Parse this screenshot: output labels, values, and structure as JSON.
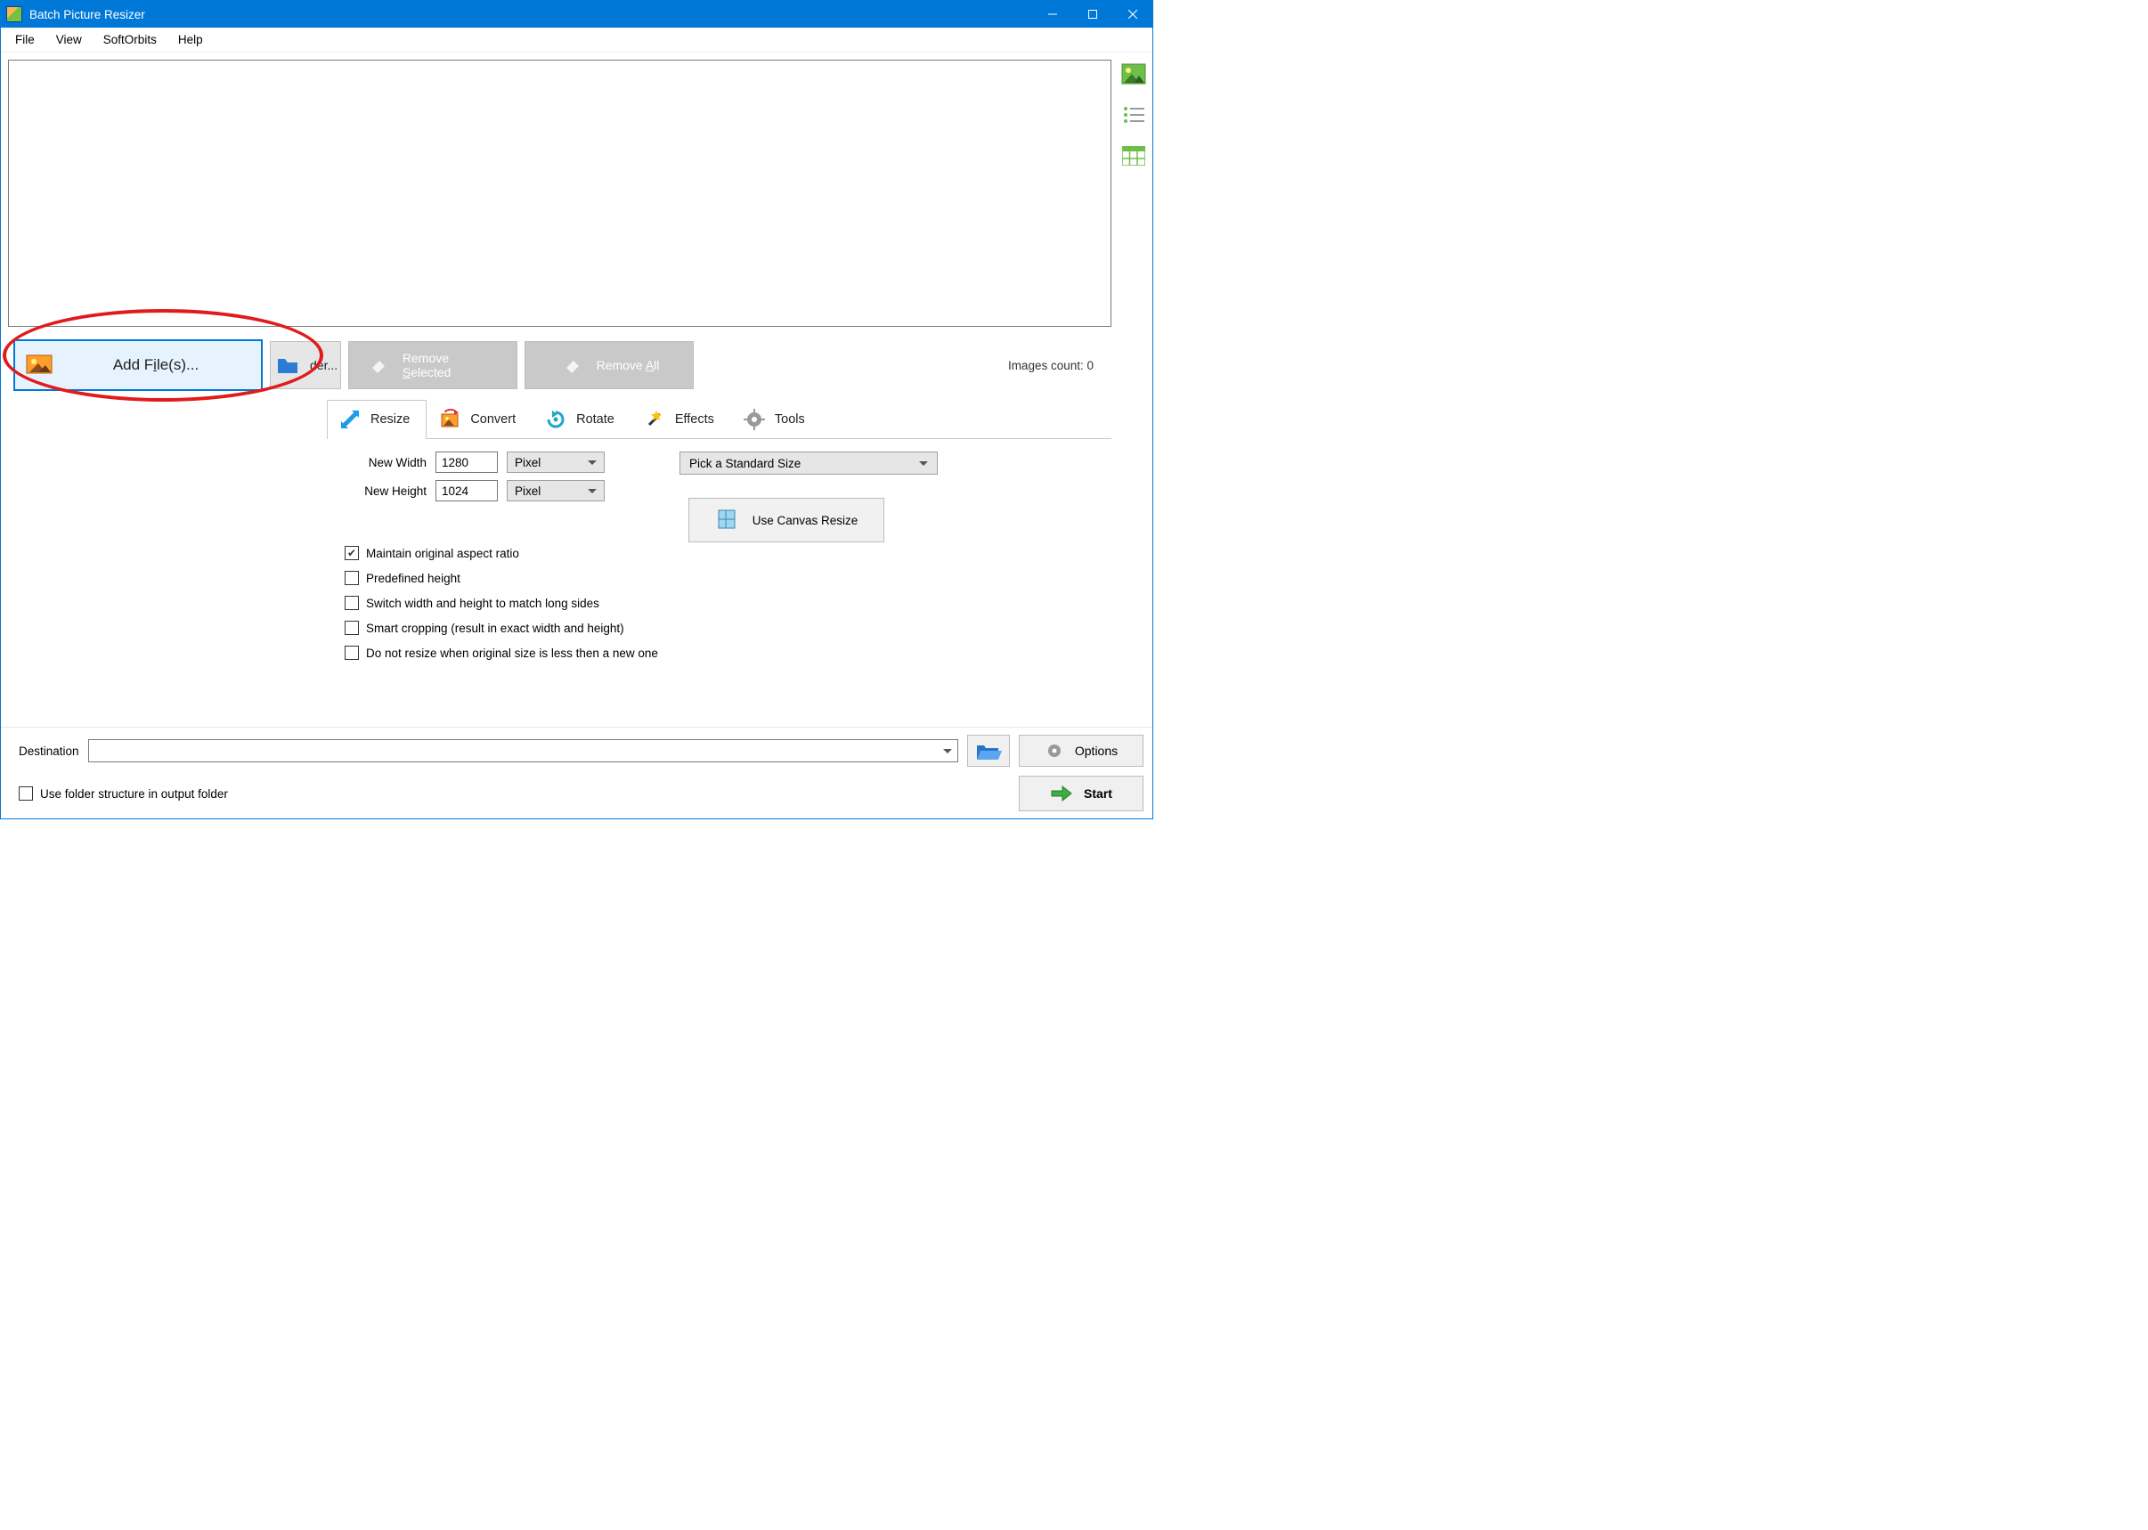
{
  "colors": {
    "accent": "#0078d7",
    "annotation": "#e11b1b"
  },
  "titlebar": {
    "title": "Batch Picture Resizer"
  },
  "menu": {
    "file": "File",
    "view": "View",
    "softorbits": "SoftOrbits",
    "help": "Help"
  },
  "fileops": {
    "add_files": "Add File(s)...",
    "add_folder_tail": "der...",
    "remove_selected_pre": "Remove ",
    "remove_selected_u": "S",
    "remove_selected_post": "elected",
    "remove_all_pre": "Remove ",
    "remove_all_u": "A",
    "remove_all_post": "ll",
    "images_count_label": "Images count: 0"
  },
  "tabs": {
    "resize": "Resize",
    "convert": "Convert",
    "rotate": "Rotate",
    "effects": "Effects",
    "tools": "Tools"
  },
  "resize": {
    "new_width_label": "New Width",
    "new_width_value": "1280",
    "new_height_label": "New Height",
    "new_height_value": "1024",
    "unit_width": "Pixel",
    "unit_height": "Pixel",
    "std_size": "Pick a Standard Size",
    "canvas_btn": "Use Canvas Resize",
    "chk_aspect": "Maintain original aspect ratio",
    "chk_predef": "Predefined height",
    "chk_switch": "Switch width and height to match long sides",
    "chk_smart": "Smart cropping (result in exact width and height)",
    "chk_noresize": "Do not resize when original size is less then a new one"
  },
  "footer": {
    "destination_label": "Destination",
    "destination_value": "",
    "options": "Options",
    "use_folder_structure": "Use folder structure in output folder",
    "start": "Start"
  }
}
